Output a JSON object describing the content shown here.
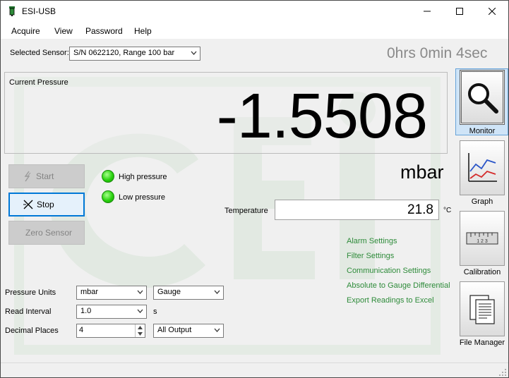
{
  "window": {
    "title": "ESI-USB"
  },
  "menu": {
    "items": [
      "Acquire",
      "View",
      "Password",
      "Help"
    ]
  },
  "sensor": {
    "label": "Selected Sensor:",
    "value": "S/N 0622120, Range 100 bar"
  },
  "elapsed": "0hrs 0min 4sec",
  "pressure": {
    "label": "Current Pressure",
    "value": "-1.5508",
    "unit": "mbar"
  },
  "buttons": {
    "start": "Start",
    "stop": "Stop",
    "zero": "Zero Sensor"
  },
  "indicators": {
    "high": "High pressure",
    "low": "Low pressure",
    "color": "#29d20e"
  },
  "temperature": {
    "label": "Temperature",
    "value": "21.8",
    "unit": "°C"
  },
  "links": [
    "Alarm Settings",
    "Filter Settings",
    "Communication Settings",
    "Absolute to Gauge Differential",
    "Export Readings to Excel"
  ],
  "settings": {
    "pressure_units": {
      "label": "Pressure Units",
      "value": "mbar",
      "mode": "Gauge"
    },
    "read_interval": {
      "label": "Read Interval",
      "value": "1.0",
      "unit": "s"
    },
    "decimal_places": {
      "label": "Decimal Places",
      "value": "4",
      "output": "All Output"
    }
  },
  "sidebar": {
    "monitor": "Monitor",
    "graph": "Graph",
    "calibration": "Calibration",
    "file_manager": "File Manager",
    "calibration_ruler": "1 2 3"
  },
  "colors": {
    "link": "#2e8b3a",
    "accent": "#0078d7",
    "watermark": "#dfe8df"
  }
}
